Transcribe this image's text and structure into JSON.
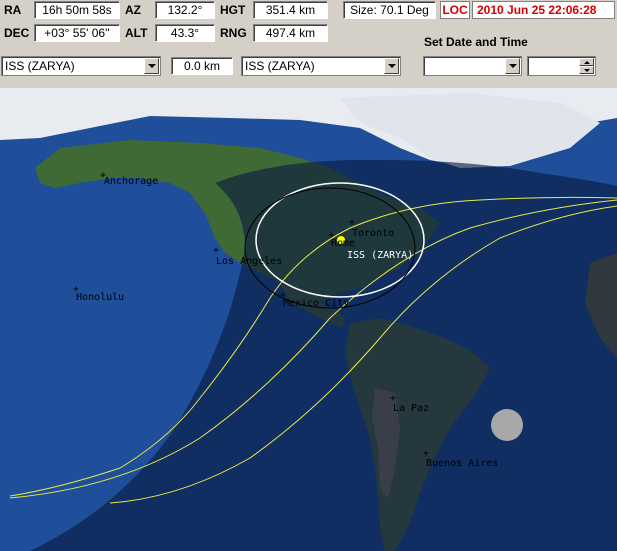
{
  "readouts": {
    "ra_label": "RA",
    "ra_value": "16h 50m 58s",
    "az_label": "AZ",
    "az_value": "132.2°",
    "hgt_label": "HGT",
    "hgt_value": "351.4 km",
    "size_value": "Size: 70.1 Deg",
    "dec_label": "DEC",
    "dec_value": "+03° 55' 06''",
    "alt_label": "ALT",
    "alt_value": "43.3°",
    "rng_label": "RNG",
    "rng_value": "497.4 km"
  },
  "time": {
    "loc_label": "LOC",
    "datetime": "2010 Jun 25    22:06:28"
  },
  "selectors": {
    "satellite_1": "ISS (ZARYA)",
    "distance": "0.0 km",
    "satellite_2": "ISS (ZARYA)",
    "set_date_time_title": "Set  Date and Time",
    "date_value": "",
    "time_value": ""
  },
  "map": {
    "satellite_label": "ISS (ZARYA)",
    "cities": [
      "Anchorage",
      "Toronto",
      "Rome",
      "Los Angeles",
      "Honolulu",
      "Mexico City",
      "La Paz",
      "Buenos Aires"
    ],
    "colors": {
      "ocean": "#1f4f9a",
      "night": "#0a1a40",
      "track": "#e8e84a",
      "footprint": "#ffffff",
      "satellite": "#ffff00",
      "moon": "#a8a8a8"
    }
  }
}
